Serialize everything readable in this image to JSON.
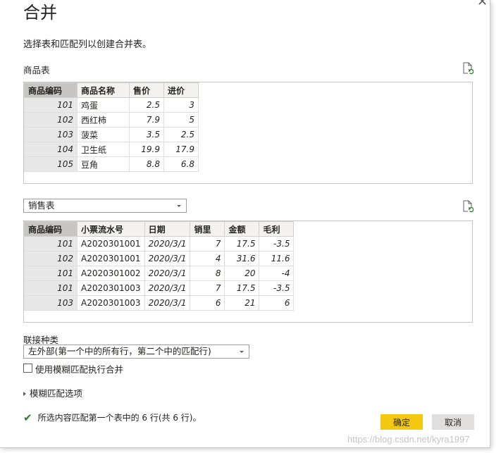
{
  "dialog": {
    "title": "合并",
    "description": "选择表和匹配列以创建合并表。",
    "close_glyph": "✕"
  },
  "table1": {
    "label": "商品表",
    "columns": [
      "商品编码",
      "商品名称",
      "售价",
      "进价"
    ],
    "rows": [
      [
        "101",
        "鸡蛋",
        "2.5",
        "3"
      ],
      [
        "102",
        "西红柿",
        "7.9",
        "5"
      ],
      [
        "103",
        "菠菜",
        "3.5",
        "2.5"
      ],
      [
        "104",
        "卫生纸",
        "19.9",
        "17.9"
      ],
      [
        "105",
        "豆角",
        "8.8",
        "6.8"
      ]
    ]
  },
  "table2": {
    "selected": "销售表",
    "columns": [
      "商品编码",
      "小票流水号",
      "日期",
      "销里",
      "金额",
      "毛利"
    ],
    "rows": [
      [
        "101",
        "A2020301001",
        "2020/3/1",
        "7",
        "17.5",
        "-3.5"
      ],
      [
        "102",
        "A2020301001",
        "2020/3/1",
        "4",
        "31.6",
        "11.6"
      ],
      [
        "101",
        "A2020301002",
        "2020/3/1",
        "8",
        "20",
        "-4"
      ],
      [
        "101",
        "A2020301003",
        "2020/3/1",
        "7",
        "17.5",
        "-3.5"
      ],
      [
        "103",
        "A2020301003",
        "2020/3/1",
        "6",
        "21",
        "6"
      ]
    ]
  },
  "join": {
    "label": "联接种类",
    "selected": "左外部(第一个中的所有行，第二个中的匹配行)"
  },
  "fuzzy": {
    "checkbox_label": "使用模糊匹配执行合并",
    "options_label": "模糊匹配选项"
  },
  "status": {
    "text": "所选内容匹配第一个表中的 6 行(共 6 行)。"
  },
  "buttons": {
    "ok": "确定",
    "cancel": "取消"
  },
  "watermark": "https://blog.csdn.net/kyra1997",
  "colors": {
    "ok_button": "#f2c811",
    "check_icon": "#2e7d32",
    "selected_column_header": "#c8c6c4"
  }
}
